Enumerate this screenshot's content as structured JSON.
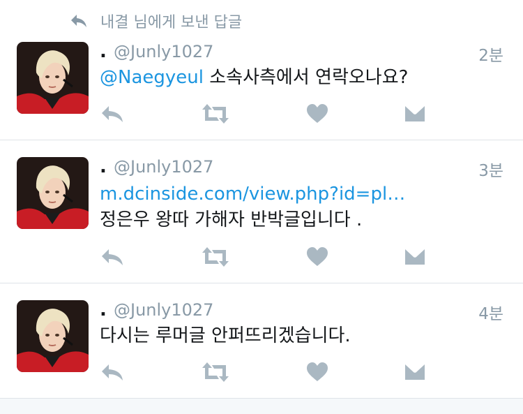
{
  "reply_context": {
    "text": "내결 님에게 보낸 답글",
    "icon": "reply-icon"
  },
  "tweets": [
    {
      "author_name": ".",
      "handle": "@Junly1027",
      "time": "2분",
      "mention": "@Naegyeul",
      "text": " 소속사측에서 연락오나요?",
      "link": "",
      "text2": ""
    },
    {
      "author_name": ".",
      "handle": "@Junly1027",
      "time": "3분",
      "mention": "",
      "text": "",
      "link": "m.dcinside.com/view.php?id=pl…",
      "text2": "정은우 왕따 가해자 반박글입니다 ."
    },
    {
      "author_name": ".",
      "handle": "@Junly1027",
      "time": "4분",
      "mention": "",
      "text": "다시는 루머글 안퍼뜨리겠습니다.",
      "link": "",
      "text2": ""
    }
  ],
  "action_icons": [
    "reply-icon",
    "retweet-icon",
    "like-icon",
    "direct-message-icon"
  ],
  "colors": {
    "accent": "#1b95e0",
    "muted": "#8899a6",
    "divider": "#dfe3e8"
  }
}
